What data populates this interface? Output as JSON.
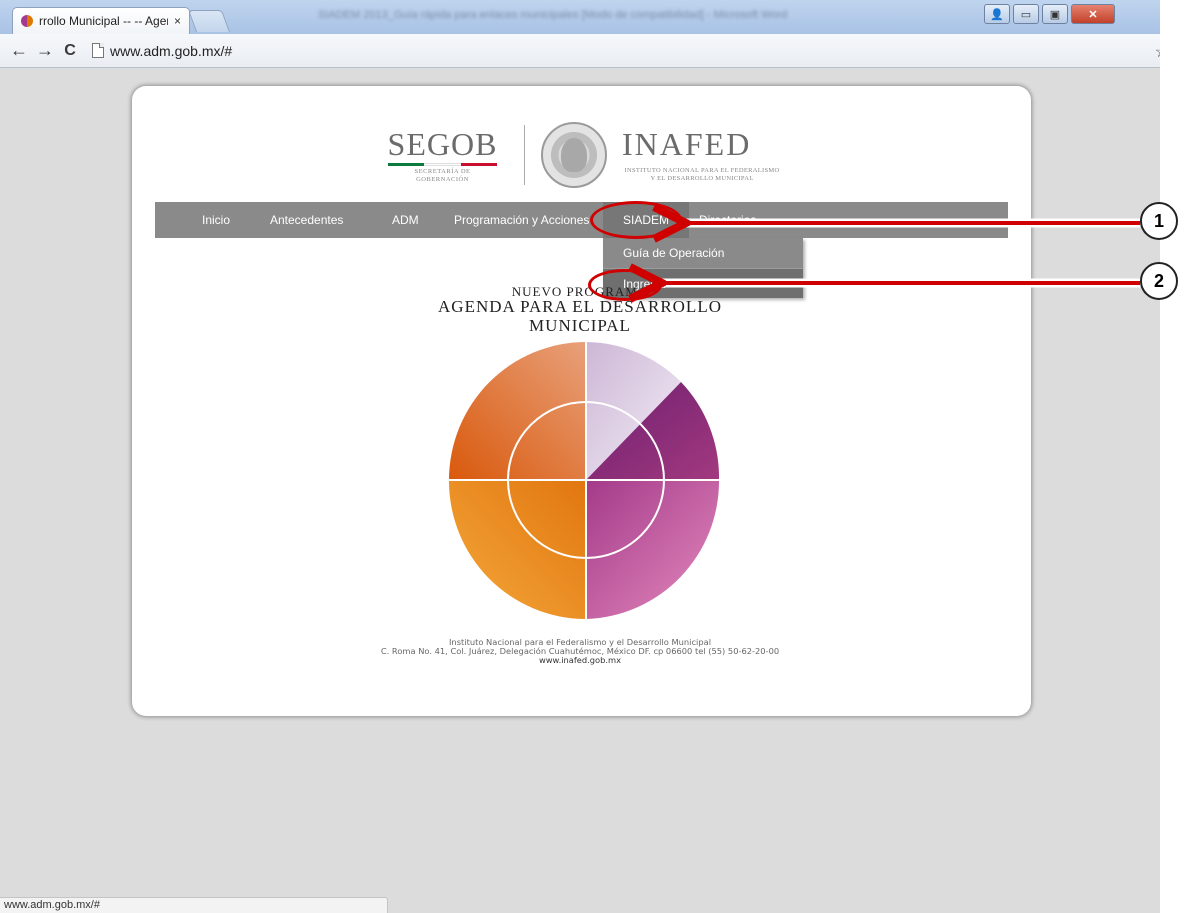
{
  "browser": {
    "tab_title": "rrollo Municipal -- -- Agen",
    "tab_close": "×",
    "window_title": "SIADEM 2013_Guía rápida para enlaces municipales [Modo de compatibilidad] - Microsoft Word",
    "url": "www.adm.gob.mx/#",
    "status_url": "www.adm.gob.mx/#",
    "back": "←",
    "forward": "→",
    "reload": "C",
    "bookmark_star": "☆",
    "window_buttons": {
      "profile": "👤",
      "minimize": "▭",
      "maximize": "▣",
      "close": "✕"
    }
  },
  "site": {
    "segob": {
      "name": "SEGOB",
      "subtitle": "SECRETARÍA DE\nGOBERNACIÓN"
    },
    "inafed": {
      "name": "INAFED",
      "subtitle": "INSTITUTO NACIONAL PARA EL FEDERALISMO\nY EL DESARROLLO MUNICIPAL"
    },
    "nav": {
      "items": [
        "Inicio",
        "Antecedentes",
        "ADM",
        "Programación y Acciones",
        "SIADEM",
        "Directorios"
      ],
      "active": "SIADEM"
    },
    "dropdown": [
      "Guía de Operación",
      "Ingresar"
    ],
    "program": {
      "kicker": "NUEVO PROGRAMA",
      "title_line1": "AGENDA PARA EL DESARROLLO",
      "title_line2": "MUNICIPAL"
    },
    "footer": {
      "line1": "Instituto Nacional para el Federalismo y el Desarrollo Municipal",
      "line2": "C. Roma No. 41, Col. Juárez, Delegación Cuahutémoc, México DF. cp 06600 tel (55) 50-62-20-00",
      "web": "www.inafed.gob.mx"
    }
  },
  "annotations": {
    "step1": "1",
    "step2": "2",
    "color": "#d00000"
  },
  "colors": {
    "nav_bg": "#8a8a8a",
    "segob_bar": [
      "#0b7a3d",
      "#ffffff",
      "#c8102e"
    ],
    "wheel": [
      "#e8a07a",
      "#dcd0e6",
      "#7b2a7a",
      "#c04f9b",
      "#f09a2a",
      "#e0620a"
    ]
  }
}
